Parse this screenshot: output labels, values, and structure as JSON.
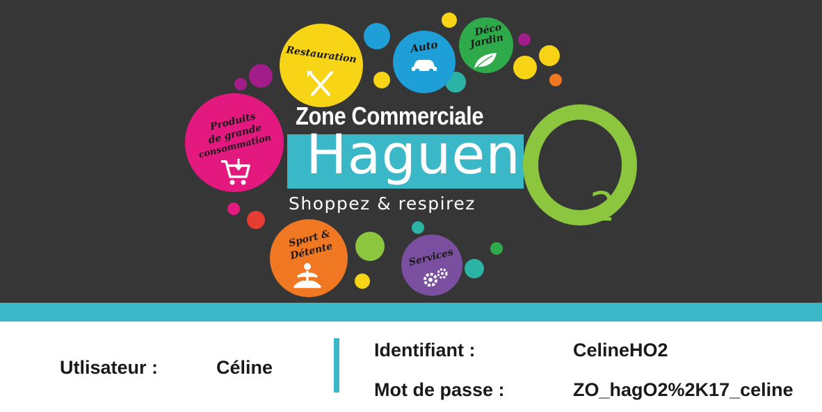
{
  "banner": {
    "zone_title": "Zone Commerciale",
    "brand_name": "Haguen",
    "brand_letter": "O",
    "brand_subscript": "2",
    "tagline": "Shoppez & respirez",
    "categories": {
      "restauration": "Restauration",
      "auto": "Auto",
      "deco_line1": "Déco",
      "deco_line2": "Jardin",
      "produits_line1": "Produits",
      "produits_line2": "de grande",
      "produits_line3": "consommation",
      "sport_line1": "Sport &",
      "sport_line2": "Détente",
      "services": "Services"
    },
    "colors": {
      "background": "#363636",
      "accent_cyan": "#3ab8c8",
      "accent_green": "#8cc63f",
      "restauration": "#f7d416",
      "auto": "#1f9fd8",
      "deco": "#2faa4a",
      "produits": "#e4197f",
      "sport": "#f07822",
      "services": "#7a4fa0"
    }
  },
  "credentials": {
    "user_label": "Utlisateur :",
    "user_value": "Céline",
    "id_label": "Identifiant :",
    "id_value": "CelineHO2",
    "password_label": "Mot de passe :",
    "password_value": "ZO_hagO2%2K17_celine"
  }
}
